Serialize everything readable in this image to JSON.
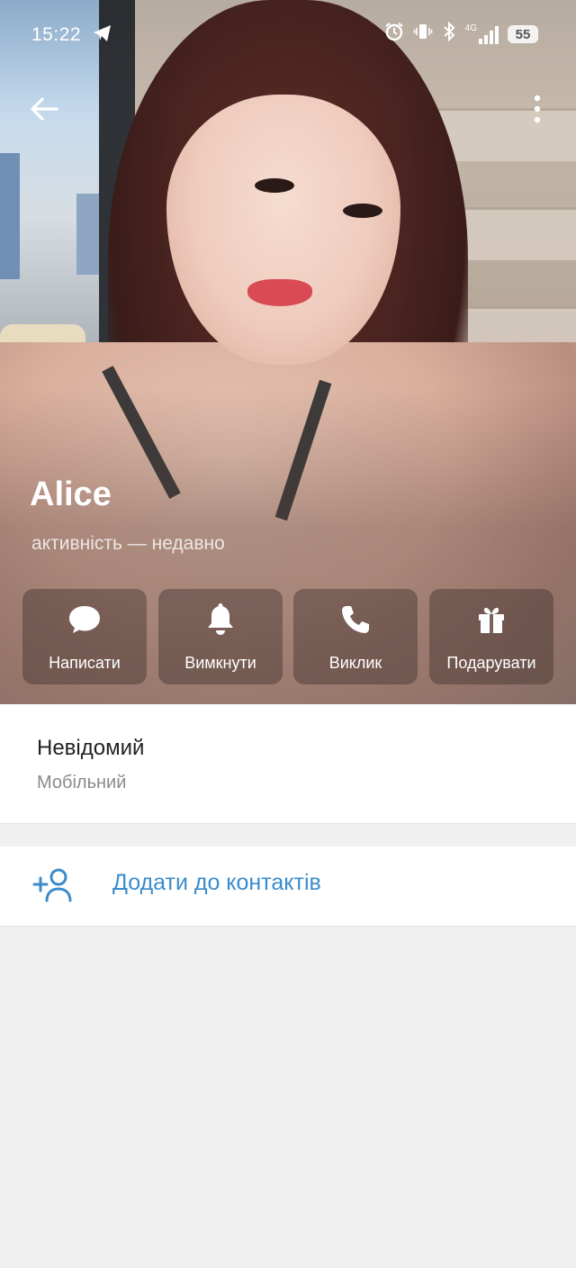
{
  "status_bar": {
    "time": "15:22",
    "battery": "55",
    "network": "4G"
  },
  "profile": {
    "name": "Alice",
    "presence": "активність — недавно"
  },
  "actions": [
    {
      "label": "Написати",
      "icon": "message-icon"
    },
    {
      "label": "Вимкнути",
      "icon": "bell-icon"
    },
    {
      "label": "Виклик",
      "icon": "phone-icon"
    },
    {
      "label": "Подарувати",
      "icon": "gift-icon"
    }
  ],
  "phone": {
    "value": "Невідомий",
    "label": "Мобільний"
  },
  "add_contact": {
    "label": "Додати до контактів",
    "icon": "add-user-icon"
  },
  "colors": {
    "link_blue": "#3a8ccc",
    "page_background": "#f0f0f0",
    "card_background": "#ffffff",
    "secondary_text": "#8a8a8a"
  }
}
